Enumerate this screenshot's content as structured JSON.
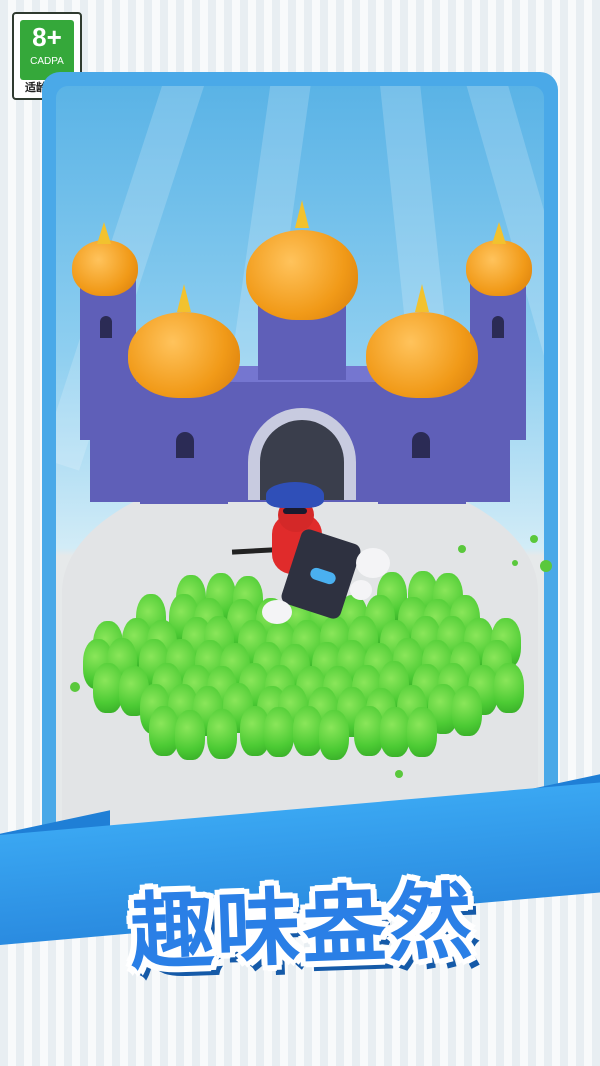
{
  "age_rating": {
    "age": "8+",
    "org": "CADPA",
    "hint": "适龄提示"
  },
  "banner": {
    "title": "趣味盎然"
  },
  "colors": {
    "accent": "#2a7fe6",
    "frame": "#4aa9e8",
    "crowd": "#4ccb34",
    "castle": "#5f5fb8",
    "dome": "#f19a18"
  }
}
